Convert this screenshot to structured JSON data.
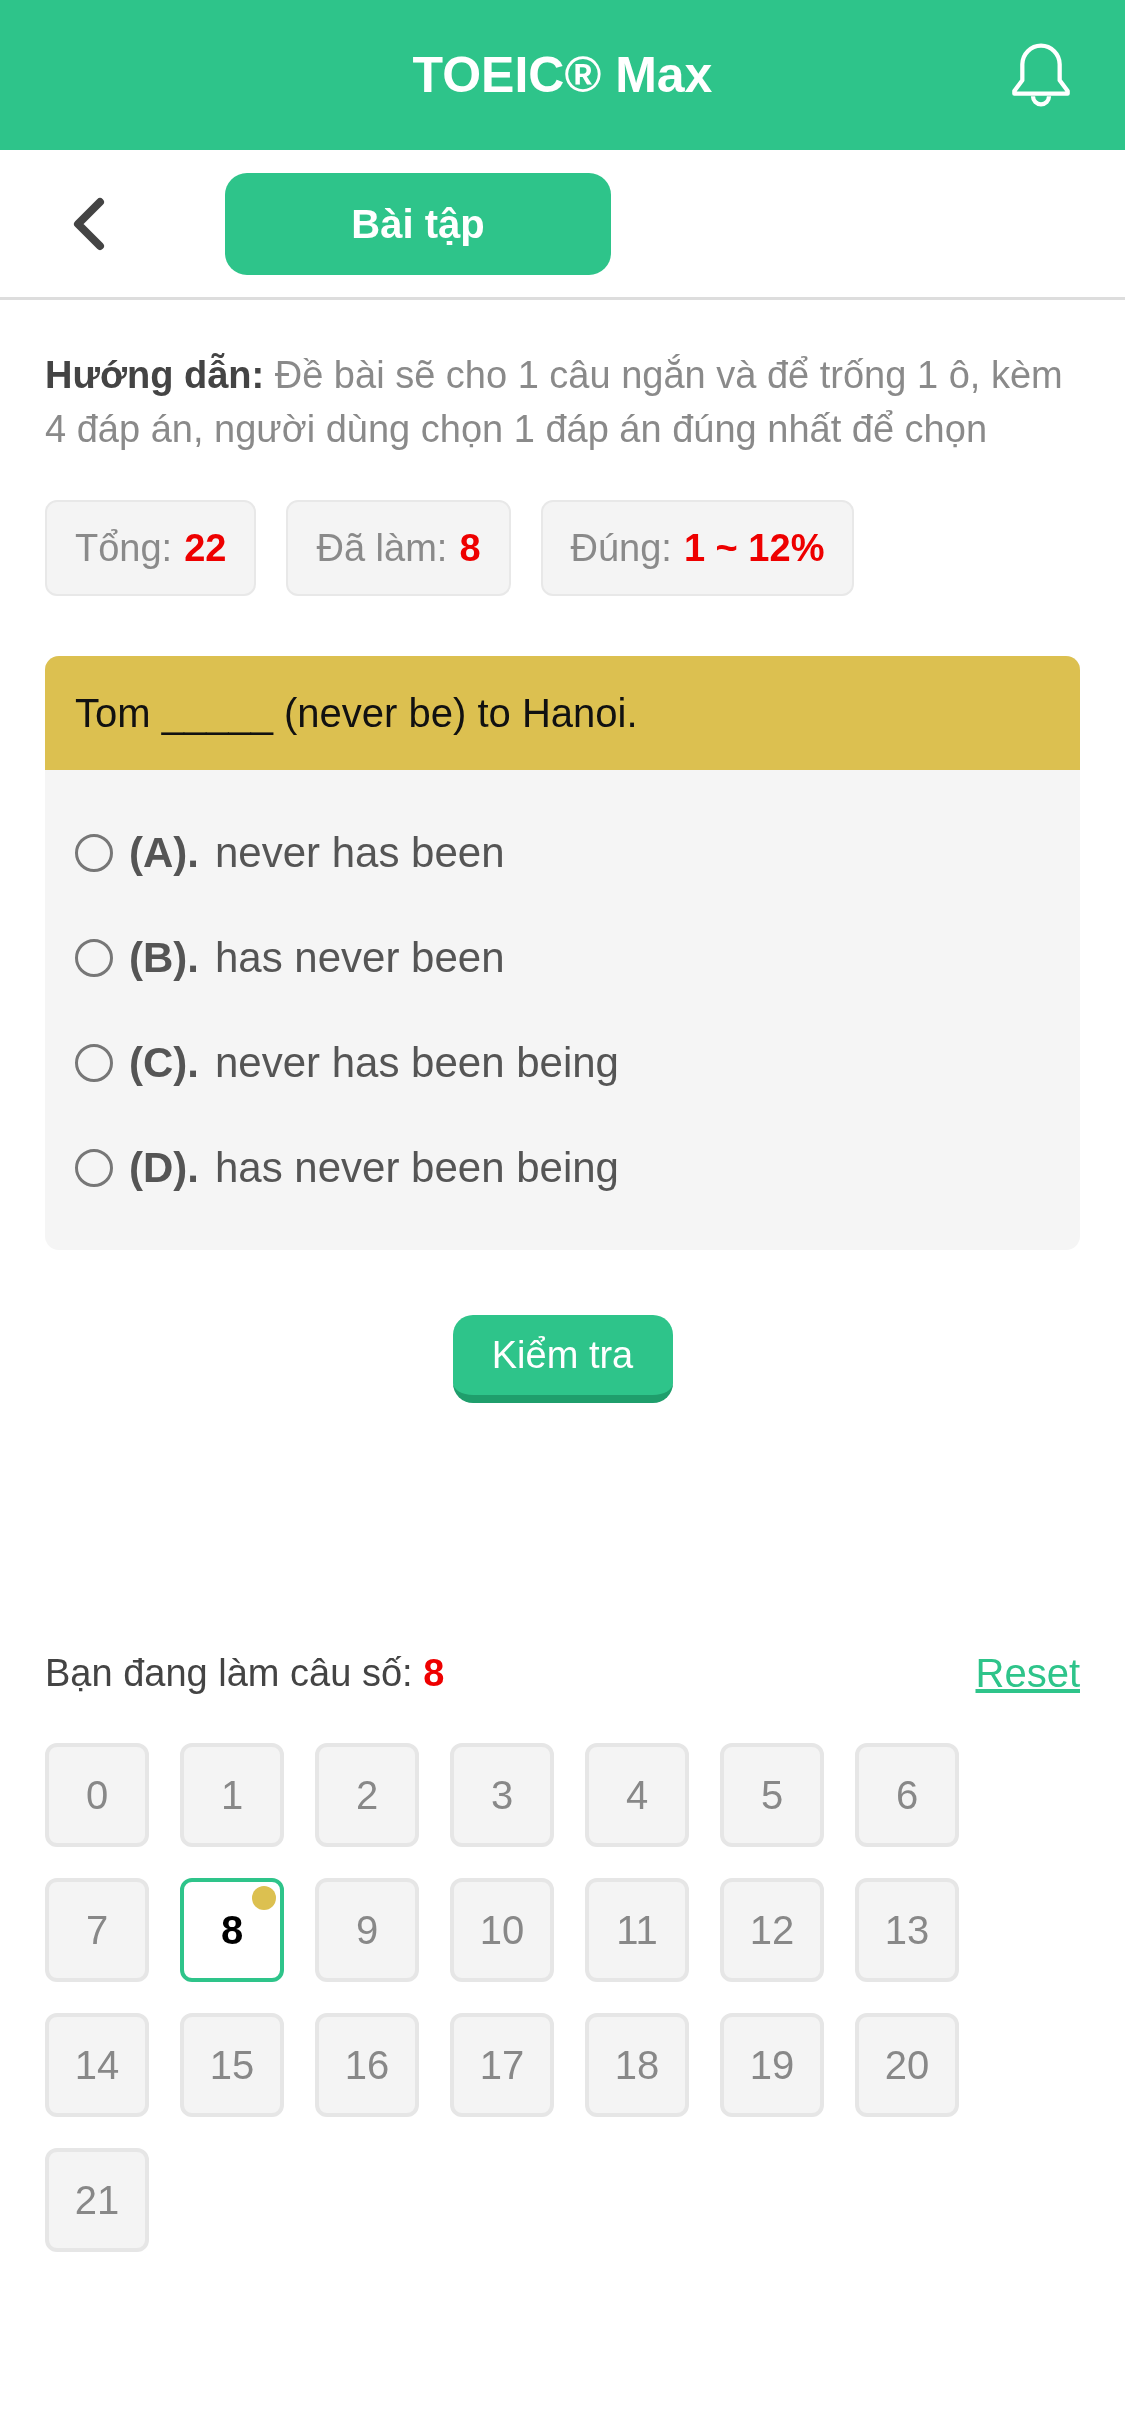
{
  "app_bar": {
    "title": "TOEIC® Max"
  },
  "nav": {
    "tab_label": "Bài tập"
  },
  "instructions": "**Hướng dẫn:** Đề bài sẽ cho 1 câu ngắn và để trống 1 ô, kèm 4 đáp án, người dùng chọn 1 đáp án đúng nhất để chọn",
  "stats": [
    {
      "label": "Tổng:",
      "value": "22"
    },
    {
      "label": "Đã làm:",
      "value": "8"
    },
    {
      "label": "Đúng:",
      "value": "1 ~ 12%"
    }
  ],
  "question": {
    "prompt": "Tom _____ (never be) to Hanoi.",
    "options": [
      {
        "letter": "(A).",
        "text": "never has been",
        "selected": false
      },
      {
        "letter": "(B).",
        "text": "has never been",
        "selected": false
      },
      {
        "letter": "(C).",
        "text": "never has been being",
        "selected": false
      },
      {
        "letter": "(D).",
        "text": "has never been being",
        "selected": false
      }
    ]
  },
  "check_button": "Kiểm tra",
  "progress": {
    "label": "Bạn đang làm câu số:",
    "current": "8",
    "reset": "Reset"
  },
  "questions": [
    {
      "label": "0",
      "selected": false,
      "flagged": false
    },
    {
      "label": "1",
      "selected": false,
      "flagged": false
    },
    {
      "label": "2",
      "selected": false,
      "flagged": false
    },
    {
      "label": "3",
      "selected": false,
      "flagged": false
    },
    {
      "label": "4",
      "selected": false,
      "flagged": false
    },
    {
      "label": "5",
      "selected": false,
      "flagged": false
    },
    {
      "label": "6",
      "selected": false,
      "flagged": false
    },
    {
      "label": "7",
      "selected": false,
      "flagged": false
    },
    {
      "label": "8",
      "selected": true,
      "flagged": true
    },
    {
      "label": "9",
      "selected": false,
      "flagged": false
    },
    {
      "label": "10",
      "selected": false,
      "flagged": false
    },
    {
      "label": "11",
      "selected": false,
      "flagged": false
    },
    {
      "label": "12",
      "selected": false,
      "flagged": false
    },
    {
      "label": "13",
      "selected": false,
      "flagged": false
    },
    {
      "label": "14",
      "selected": false,
      "flagged": false
    },
    {
      "label": "15",
      "selected": false,
      "flagged": false
    },
    {
      "label": "16",
      "selected": false,
      "flagged": false
    },
    {
      "label": "17",
      "selected": false,
      "flagged": false
    },
    {
      "label": "18",
      "selected": false,
      "flagged": false
    },
    {
      "label": "19",
      "selected": false,
      "flagged": false
    },
    {
      "label": "20",
      "selected": false,
      "flagged": false
    },
    {
      "label": "21",
      "selected": false,
      "flagged": false
    }
  ]
}
